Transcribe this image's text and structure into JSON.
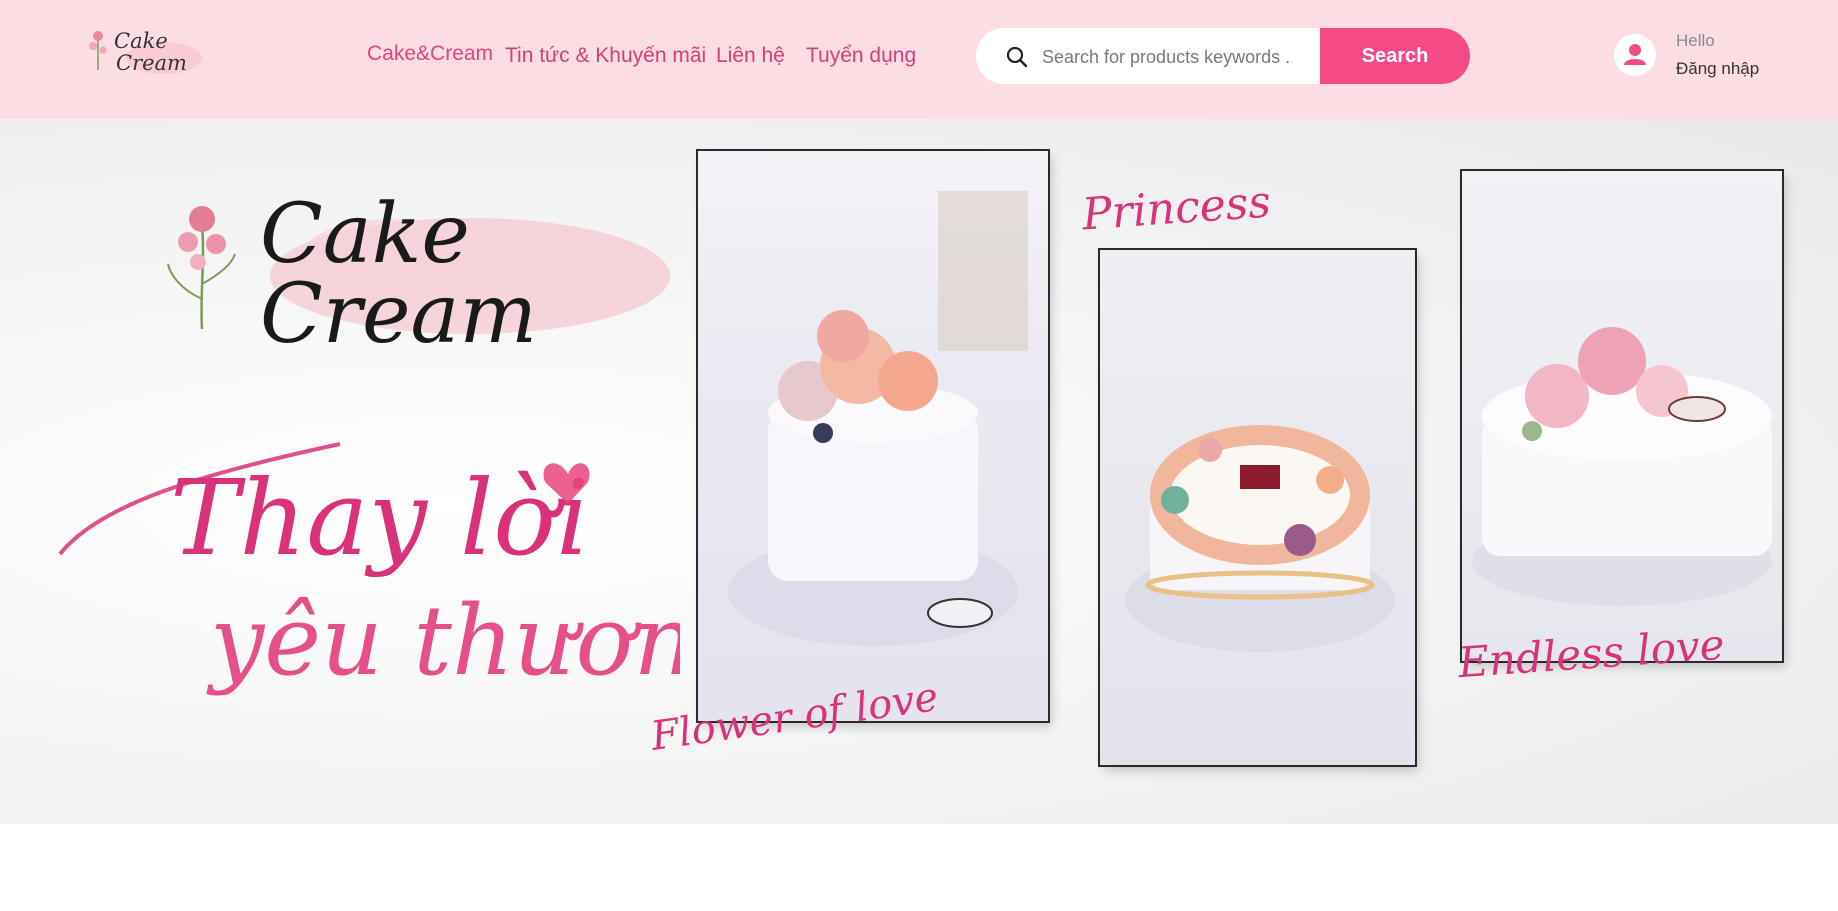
{
  "header": {
    "logo_text": [
      "Cake",
      "Cream"
    ],
    "nav": [
      "Cake&Cream",
      "Tin tức & Khuyến mãi",
      "Liên hệ",
      "Tuyển dụng"
    ],
    "search": {
      "placeholder": "Search for products keywords ...",
      "button": "Search"
    },
    "user": {
      "greeting": "Hello",
      "login": "Đăng nhập"
    }
  },
  "hero": {
    "brand_lines": [
      "Cake",
      "Cream"
    ],
    "tagline_lines": [
      "Thay lời",
      "yêu thương"
    ],
    "captions": [
      "Flower of love",
      "Princess",
      "Endless love"
    ]
  },
  "colors": {
    "header_bg": "#fcdde4",
    "accent": "#f54a86",
    "nav_text": "#d63e7a"
  }
}
